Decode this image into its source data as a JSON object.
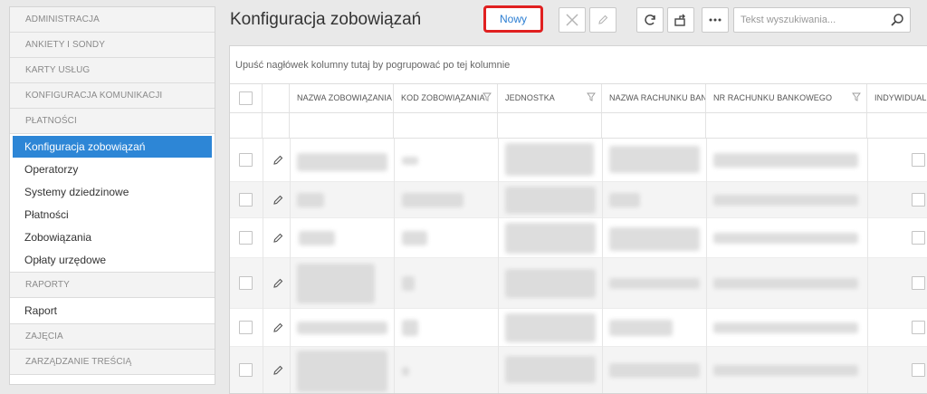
{
  "sidebar": {
    "sections": {
      "administracja": "ADMINISTRACJA",
      "ankiety": "ANKIETY I SONDY",
      "karty": "KARTY USŁUG",
      "konfiguracja_komunikacji": "KONFIGURACJA KOMUNIKACJI",
      "platnosci": "PŁATNOŚCI",
      "raporty": "RAPORTY",
      "zajecia": "ZAJĘCIA",
      "zarzadzanie": "ZARZĄDZANIE TREŚCIĄ"
    },
    "items": [
      {
        "label": "Konfiguracja zobowiązań",
        "active": true
      },
      {
        "label": "Operatorzy"
      },
      {
        "label": "Systemy dziedzinowe"
      },
      {
        "label": "Płatności"
      },
      {
        "label": "Zobowiązania"
      },
      {
        "label": "Opłaty urzędowe"
      }
    ],
    "raport_item": "Raport"
  },
  "header": {
    "title": "Konfiguracja zobowiązań",
    "new_button": "Nowy",
    "highlight_color": "#e02020",
    "tools": [
      "close-icon",
      "pencil-icon",
      "refresh-icon",
      "export-icon",
      "more-icon"
    ]
  },
  "search": {
    "placeholder": "Tekst wyszukiwania..."
  },
  "grid": {
    "group_panel_text": "Upuść nagłówek kolumny tutaj by pogrupować po tej kolumnie",
    "columns": [
      {
        "label": "NAZWA ZOBOWIĄZANIA",
        "filter": false
      },
      {
        "label": "KOD ZOBOWIĄZANIA",
        "filter": true
      },
      {
        "label": "JEDNOSTKA",
        "filter": true
      },
      {
        "label": "NAZWA RACHUNKU BANKOWEGO",
        "filter": false
      },
      {
        "label": "NR RACHUNKU BANKOWEGO",
        "filter": true
      },
      {
        "label": "INDYWIDUALNY",
        "filter": false
      }
    ],
    "row_count": 6
  },
  "colors": {
    "accent": "#2d86d6",
    "link": "#2d7fd3"
  }
}
